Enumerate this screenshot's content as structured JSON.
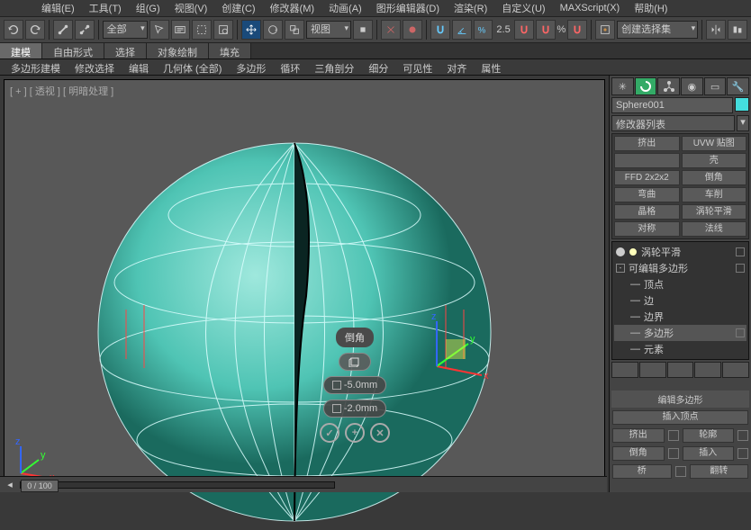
{
  "menus": [
    "编辑(E)",
    "工具(T)",
    "组(G)",
    "视图(V)",
    "创建(C)",
    "修改器(M)",
    "动画(A)",
    "图形编辑器(D)",
    "渲染(R)",
    "自定义(U)",
    "MAXScript(X)",
    "帮助(H)"
  ],
  "toolbar": {
    "scope_dd": "全部",
    "view_dd": "视图",
    "spinner": "2.5",
    "selset_dd": "创建选择集"
  },
  "tabs": [
    "建模",
    "自由形式",
    "选择",
    "对象绘制",
    "填充"
  ],
  "tabs_active": 0,
  "subtabs": [
    "多边形建模",
    "修改选择",
    "编辑",
    "几何体 (全部)",
    "多边形",
    "循环",
    "三角剖分",
    "细分",
    "可见性",
    "对齐",
    "属性"
  ],
  "viewport_label": "[ + ] [ 透视 ] [ 明暗处理 ]",
  "caddy": {
    "title": "倒角",
    "val1": "-5.0mm",
    "val2": "-2.0mm"
  },
  "object_name": "Sphere001",
  "modifier_dd": "修改器列表",
  "mod_buttons": [
    "挤出",
    "UVW 贴图",
    "",
    "壳",
    "FFD 2x2x2",
    "倒角",
    "弯曲",
    "车削",
    "晶格",
    "涡轮平滑",
    "对称",
    "法线"
  ],
  "stack": {
    "items": [
      {
        "lvl": 0,
        "txt": "涡轮平滑",
        "bulb": true,
        "end": true
      },
      {
        "lvl": 0,
        "txt": "可编辑多边形",
        "toggle": "-",
        "end": true
      },
      {
        "lvl": 1,
        "txt": "顶点"
      },
      {
        "lvl": 1,
        "txt": "边"
      },
      {
        "lvl": 1,
        "txt": "边界"
      },
      {
        "lvl": 1,
        "txt": "多边形",
        "sel": true,
        "end": true
      },
      {
        "lvl": 1,
        "txt": "元素"
      }
    ]
  },
  "rollout1": "编辑多边形",
  "insert_vertex": "插入顶点",
  "poly_ops": [
    [
      "挤出",
      "轮廓"
    ],
    [
      "倒角",
      "插入"
    ],
    [
      "桥",
      "翻转"
    ]
  ],
  "timeline": {
    "pos": "0",
    "range": "0 / 100"
  }
}
